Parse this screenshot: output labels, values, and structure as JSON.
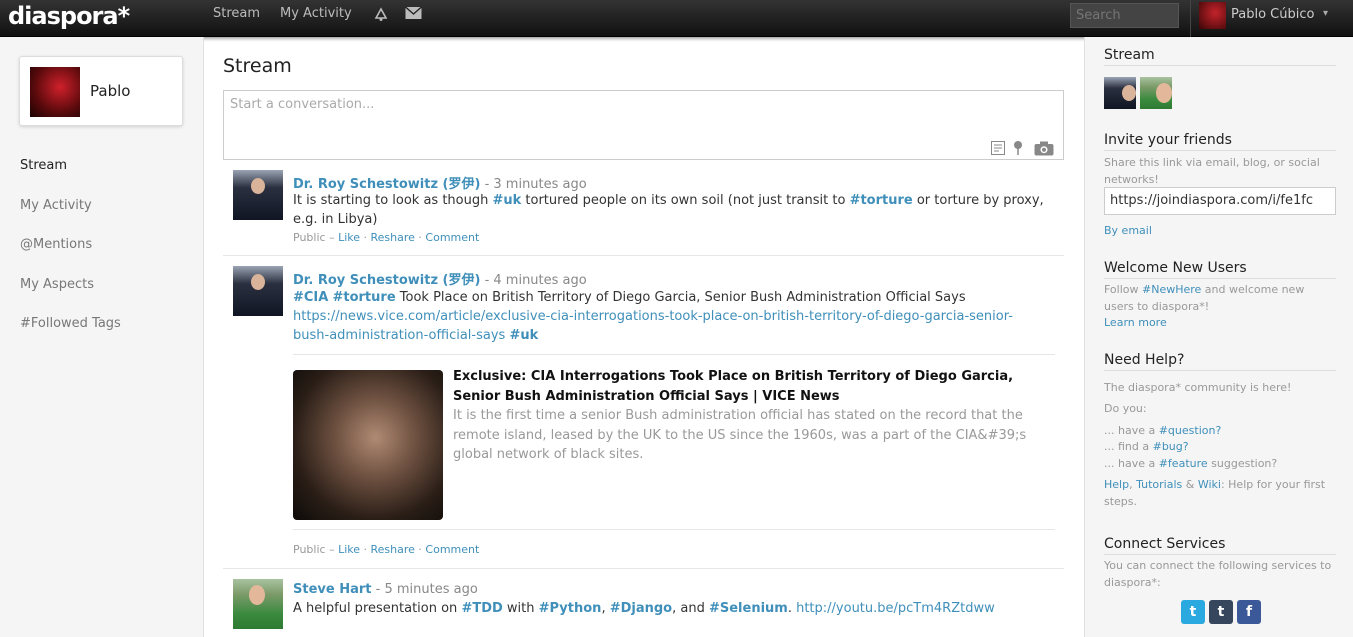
{
  "header": {
    "logo": "diaspora*",
    "nav": [
      "Stream",
      "My Activity"
    ],
    "search_placeholder": "Search",
    "user_name": "Pablo Cúbico",
    "caret": "▾"
  },
  "left": {
    "profile_name": "Pablo",
    "nav": [
      "Stream",
      "My Activity",
      "@Mentions",
      "My Aspects",
      "#Followed Tags"
    ]
  },
  "main": {
    "title": "Stream",
    "publisher_placeholder": "Start a conversation...",
    "posts": [
      {
        "author": "Dr. Roy Schestowitz (罗伊)",
        "time": " - 3 minutes ago",
        "text_parts": [
          "It is starting to look as though ",
          "#uk",
          " tortured people on its own soil (not just transit to ",
          "#torture",
          " or torture by proxy,",
          "e.g. in Libya)"
        ],
        "meta": {
          "visibility": "Public – ",
          "like": "Like",
          "reshare": "Reshare",
          "comment": "Comment"
        }
      },
      {
        "author": "Dr. Roy Schestowitz (罗伊)",
        "time": " - 4 minutes ago",
        "text_parts": [
          "#CIA",
          "#torture",
          " Took Place on British Territory of Diego Garcia, Senior Bush Administration Official Says",
          "https://news.vice.com/article/exclusive-cia-interrogations-took-place-on-british-territory-of-diego-garcia-senior-",
          "bush-administration-official-says",
          "#uk"
        ],
        "card_title": "Exclusive: CIA Interrogations Took Place on British Territory of Diego Garcia, Senior Bush Administration Official Says | VICE News",
        "card_desc": "It is the first time a senior Bush administration official has stated on the record that the remote island, leased by the UK to the US since the 1960s, was a part of the CIA&#39;s global network of black sites.",
        "meta": {
          "visibility": "Public – ",
          "like": "Like",
          "reshare": "Reshare",
          "comment": "Comment"
        }
      },
      {
        "author": "Steve Hart",
        "time": " - 5 minutes ago",
        "text_parts": [
          "A helpful presentation on ",
          "#TDD",
          " with ",
          "#Python",
          ", ",
          "#Django",
          ", and ",
          "#Selenium",
          ". ",
          "http://youtu.be/pcTm4RZtdww"
        ]
      }
    ]
  },
  "right": {
    "stream_title": "Stream",
    "invite_title": "Invite your friends",
    "invite_text": "Share this link via email, blog, or social networks!",
    "invite_link": "https://joindiaspora.com/i/fe1fc",
    "by_email": "By email",
    "welcome_title": "Welcome New Users",
    "welcome_pre": "Follow ",
    "welcome_tag": "#NewHere",
    "welcome_post": " and welcome new users to diaspora*!",
    "learn_more": "Learn more",
    "help_title": "Need Help?",
    "help_community": "The diaspora* community is here!",
    "help_doyou": "Do you:",
    "help_q_pre": "... have a ",
    "help_q_tag": "#question?",
    "help_b_pre": "... find a ",
    "help_b_tag": "#bug?",
    "help_f_pre": "... have a ",
    "help_f_tag": "#feature",
    "help_f_post": " suggestion?",
    "help_link1": "Help",
    "help_sep1": ", ",
    "help_link2": "Tutorials",
    "help_sep2": " & ",
    "help_link3": "Wiki",
    "help_tail": ": Help for your first steps.",
    "connect_title": "Connect Services",
    "connect_text": "You can connect the following services to diaspora*:",
    "services": [
      "t",
      "t",
      "f"
    ],
    "service_colors": [
      "#2aa9e0",
      "#36465d",
      "#3b5998"
    ]
  }
}
